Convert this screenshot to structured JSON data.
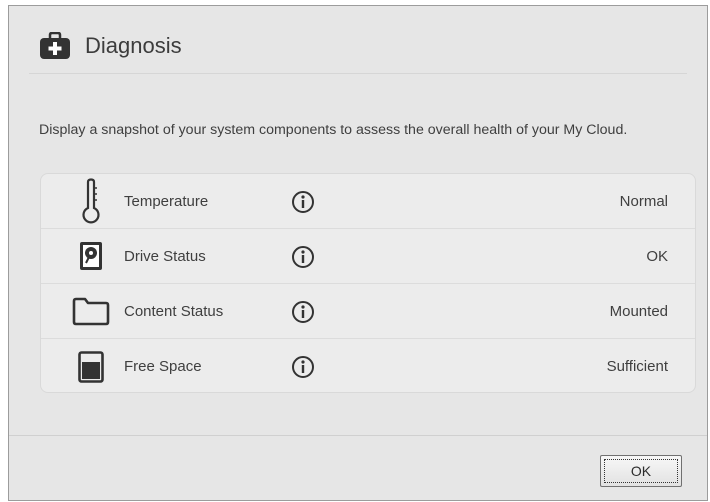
{
  "dialog": {
    "title": "Diagnosis",
    "header_icon": "first-aid-kit-icon",
    "description": "Display a snapshot of your system components to assess the overall health of your My Cloud."
  },
  "diagnostics": [
    {
      "icon": "thermometer-icon",
      "label": "Temperature",
      "value": "Normal"
    },
    {
      "icon": "hard-drive-icon",
      "label": "Drive Status",
      "value": "OK"
    },
    {
      "icon": "folder-icon",
      "label": "Content Status",
      "value": "Mounted"
    },
    {
      "icon": "storage-gauge-icon",
      "label": "Free Space",
      "value": "Sufficient"
    }
  ],
  "footer": {
    "ok_label": "OK"
  },
  "colors": {
    "dialog_bg": "#e6e6e6",
    "panel_bg": "#ececec",
    "icon": "#333333",
    "text": "#3f3f3f"
  }
}
